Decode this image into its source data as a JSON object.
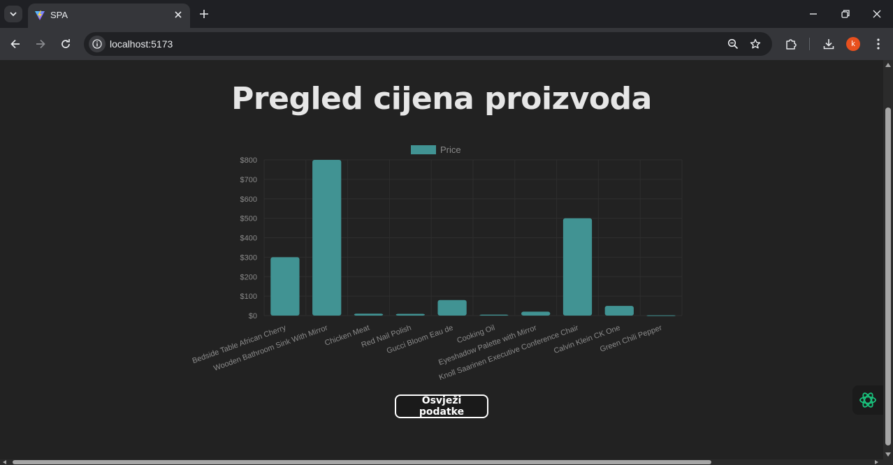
{
  "browser": {
    "tab_title": "SPA",
    "url": "localhost:5173",
    "avatar_letter": "k",
    "accent_color": "#e8501e"
  },
  "page": {
    "title": "Pregled cijena proizvoda",
    "refresh_button": "Osvježi podatke"
  },
  "icons": {
    "tab_search": "chevron-down-icon",
    "favicon": "vite-logo-icon",
    "close_tab": "close-icon",
    "new_tab": "plus-icon",
    "minimize": "minimize-icon",
    "restore": "restore-icon",
    "close_window": "close-icon",
    "back": "arrow-left-icon",
    "forward": "arrow-right-icon",
    "reload": "reload-icon",
    "site_info": "info-icon",
    "zoom": "zoom-icon",
    "bookmark": "star-icon",
    "extensions": "puzzle-icon",
    "downloads": "download-icon",
    "menu": "kebab-menu-icon",
    "assistant": "chatgpt-logo-icon"
  },
  "chart_data": {
    "type": "bar",
    "legend": [
      "Price"
    ],
    "legend_position": "top",
    "series": [
      {
        "name": "Price",
        "color": "#419393",
        "values": [
          299.99,
          799.99,
          9.99,
          8.99,
          79.99,
          4.99,
          19.99,
          499.99,
          49.99,
          1.49
        ]
      }
    ],
    "categories": [
      "Bedside Table African Cherry",
      "Wooden Bathroom Sink With Mirror",
      "Chicken Meat",
      "Red Nail Polish",
      "Gucci Bloom Eau de",
      "Cooking Oil",
      "Eyeshadow Palette with Mirror",
      "Knoll Saarinen Executive Conference Chair",
      "Calvin Klein CK One",
      "Green Chili Pepper"
    ],
    "ylim": [
      0,
      800
    ],
    "y_ticks": [
      0,
      100,
      200,
      300,
      400,
      500,
      600,
      700,
      800
    ],
    "y_tick_labels": [
      "$0",
      "$100",
      "$200",
      "$300",
      "$400",
      "$500",
      "$600",
      "$700",
      "$800"
    ],
    "grid": true
  }
}
